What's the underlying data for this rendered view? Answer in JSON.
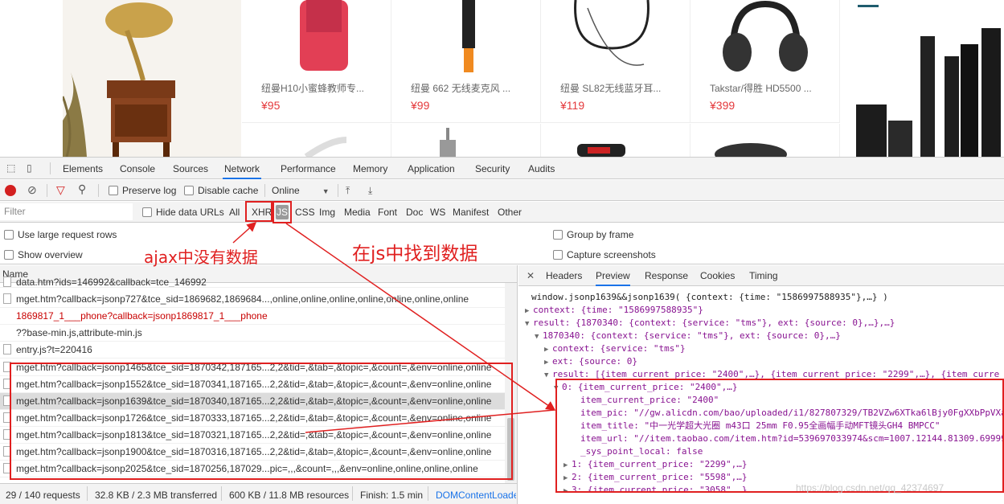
{
  "shop": {
    "products": [
      {
        "name": "纽曼H10小蜜蜂教师专...",
        "price": "¥95"
      },
      {
        "name": "纽曼 662 无线麦克风 ...",
        "price": "¥99"
      },
      {
        "name": "纽曼 SL82无线蓝牙耳...",
        "price": "¥119"
      },
      {
        "name": "Takstar/得胜 HD5500 ...",
        "price": "¥399"
      }
    ]
  },
  "devtools": {
    "tabs": [
      "Elements",
      "Console",
      "Sources",
      "Network",
      "Performance",
      "Memory",
      "Application",
      "Security",
      "Audits"
    ],
    "active_tab": "Network",
    "toolbar": {
      "preserve_log": "Preserve log",
      "disable_cache": "Disable cache",
      "throttle": "Online"
    },
    "filter": {
      "placeholder": "Filter",
      "hide_data_urls": "Hide data URLs",
      "types": [
        "All",
        "XHR",
        "JS",
        "CSS",
        "Img",
        "Media",
        "Font",
        "Doc",
        "WS",
        "Manifest",
        "Other"
      ]
    },
    "options": {
      "large_rows": "Use large request rows",
      "show_overview": "Show overview",
      "group_by_frame": "Group by frame",
      "capture_screenshots": "Capture screenshots"
    },
    "requests": {
      "header": "Name",
      "rows": [
        "data.htm?ids=146992&callback=tce_146992",
        "mget.htm?callback=jsonp727&tce_sid=1869682,1869684...,online,online,online,online,online,online,online",
        "1869817_1___phone?callback=jsonp1869817_1___phone",
        "??base-min.js,attribute-min.js",
        "entry.js?t=220416",
        "mget.htm?callback=jsonp1465&tce_sid=1870342,187165...2,2&tid=,&tab=,&topic=,&count=,&env=online,online",
        "mget.htm?callback=jsonp1552&tce_sid=1870341,187165...2,2&tid=,&tab=,&topic=,&count=,&env=online,online",
        "mget.htm?callback=jsonp1639&tce_sid=1870340,187165...2,2&tid=,&tab=,&topic=,&count=,&env=online,online",
        "mget.htm?callback=jsonp1726&tce_sid=1870333,187165...2,2&tid=,&tab=,&topic=,&count=,&env=online,online",
        "mget.htm?callback=jsonp1813&tce_sid=1870321,187165...2,2&tid=,&tab=,&topic=,&count=,&env=online,online",
        "mget.htm?callback=jsonp1900&tce_sid=1870316,187165...2,2&tid=,&tab=,&topic=,&count=,&env=online,online",
        "mget.htm?callback=jsonp2025&tce_sid=1870256,187029...pic=,,,&count=,,,&env=online,online,online,online"
      ]
    },
    "status": {
      "requests": "29 / 140 requests",
      "transferred": "32.8 KB / 2.3 MB transferred",
      "resources": "600 KB / 11.8 MB resources",
      "finish": "Finish: 1.5 min",
      "dom": "DOMContentLoade"
    },
    "preview_tabs": [
      "Headers",
      "Preview",
      "Response",
      "Cookies",
      "Timing"
    ],
    "active_preview_tab": "Preview",
    "preview": [
      "window.jsonp1639&&jsonp1639( {context: {time: \"1586997588935\"},…} )",
      "context: {time: \"1586997588935\"}",
      "result: {1870340: {context: {service: \"tms\"}, ext: {source: 0},…},…}",
      "1870340: {context: {service: \"tms\"}, ext: {source: 0},…}",
      "context: {service: \"tms\"}",
      "ext: {source: 0}",
      "result: [{item_current_price: \"2400\",…}, {item_current_price: \"2299\",…}, {item_curre",
      "0: {item_current_price: \"2400\",…}",
      "item_current_price: \"2400\"",
      "item_pic: \"//gw.alicdn.com/bao/uploaded/i1/827807329/TB2VZw6XTka6lBjy0FgXXbPpVXa",
      "item_title: \"中一光学超大光圈 m43口 25mm F0.95全画幅手动MFT镜头GH4 BMPCC\"",
      "item_url: \"//item.taobao.com/item.htm?id=539697033974&scm=1007.12144.81309.69999",
      "_sys_point_local: false",
      "1: {item_current_price: \"2299\",…}",
      "2: {item_current_price: \"5598\",…}",
      "3: {item_current_price: \"3058\",…}"
    ]
  },
  "annotations": {
    "ajax_note": "ajax中没有数据",
    "js_note": "在js中找到数据"
  },
  "watermark": "https://blog.csdn.net/qq_42374697"
}
